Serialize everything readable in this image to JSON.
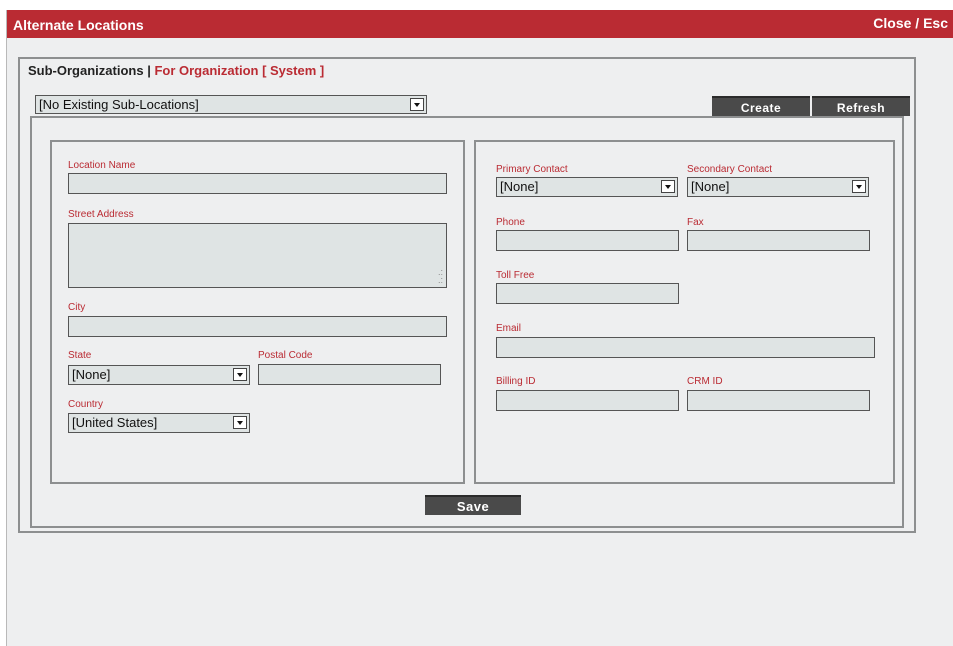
{
  "window": {
    "title": "Alternate Locations",
    "close_label": "Close / Esc"
  },
  "header": {
    "label": "Sub-Organizations",
    "separator": "|",
    "org_text": "For Organization [ System ]"
  },
  "sublocation_select": {
    "value": "[No Existing Sub-Locations]"
  },
  "buttons": {
    "create": "Create",
    "refresh": "Refresh",
    "save": "Save"
  },
  "left_form": {
    "location_name_label": "Location Name",
    "street_address_label": "Street Address",
    "city_label": "City",
    "state_label": "State",
    "state_value": "[None]",
    "postal_code_label": "Postal Code",
    "country_label": "Country",
    "country_value": "[United States]"
  },
  "right_form": {
    "primary_contact_label": "Primary Contact",
    "primary_contact_value": "[None]",
    "secondary_contact_label": "Secondary Contact",
    "secondary_contact_value": "[None]",
    "phone_label": "Phone",
    "fax_label": "Fax",
    "toll_free_label": "Toll Free",
    "email_label": "Email",
    "billing_id_label": "Billing ID",
    "crm_id_label": "CRM ID"
  },
  "colors": {
    "titlebar": "#ba2b33",
    "accent_text": "#ba2b33",
    "field_bg": "#dfe4e4",
    "button_bg": "#4a4a4a",
    "background": "#eeeff0"
  },
  "icons": {
    "dropdown": "chevron-down-icon",
    "resize": "resize-grip-icon"
  }
}
